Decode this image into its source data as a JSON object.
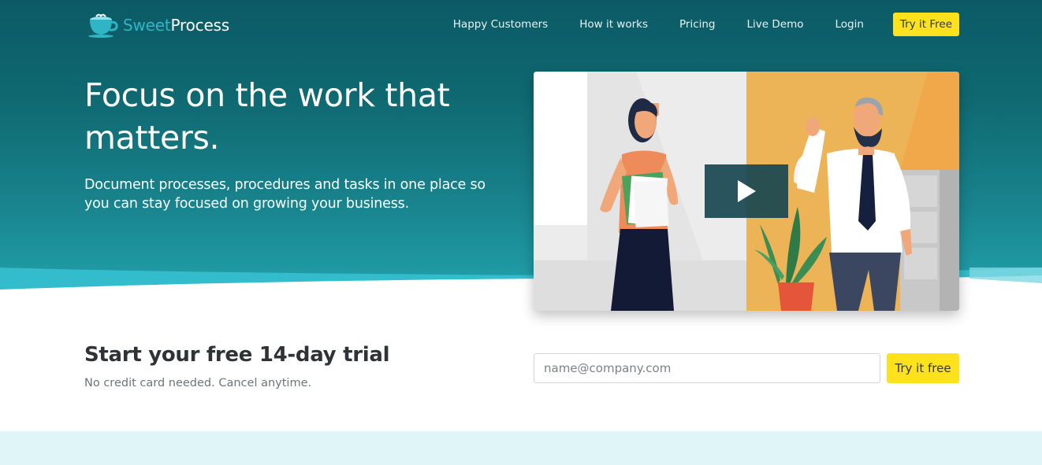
{
  "brand": {
    "name_part1": "Sweet",
    "name_part2": "Process"
  },
  "nav": {
    "links": [
      "Happy Customers",
      "How it works",
      "Pricing",
      "Live Demo",
      "Login"
    ],
    "cta_label": "Try it Free"
  },
  "hero": {
    "headline": "Focus on the work that matters.",
    "subheadline": "Document processes, procedures and tasks in one place so you can stay focused on growing your business."
  },
  "video": {
    "play_icon": "play-icon"
  },
  "trial": {
    "title": "Start your free 14-day trial",
    "subtitle": "No credit card needed. Cancel anytime.",
    "email_placeholder": "name@company.com",
    "button_label": "Try it free"
  },
  "colors": {
    "accent_yellow": "#ffe11c",
    "hero_teal": "#0f6870",
    "brand_light_teal": "#2fb5c4",
    "band_light": "#e0f5f7"
  }
}
